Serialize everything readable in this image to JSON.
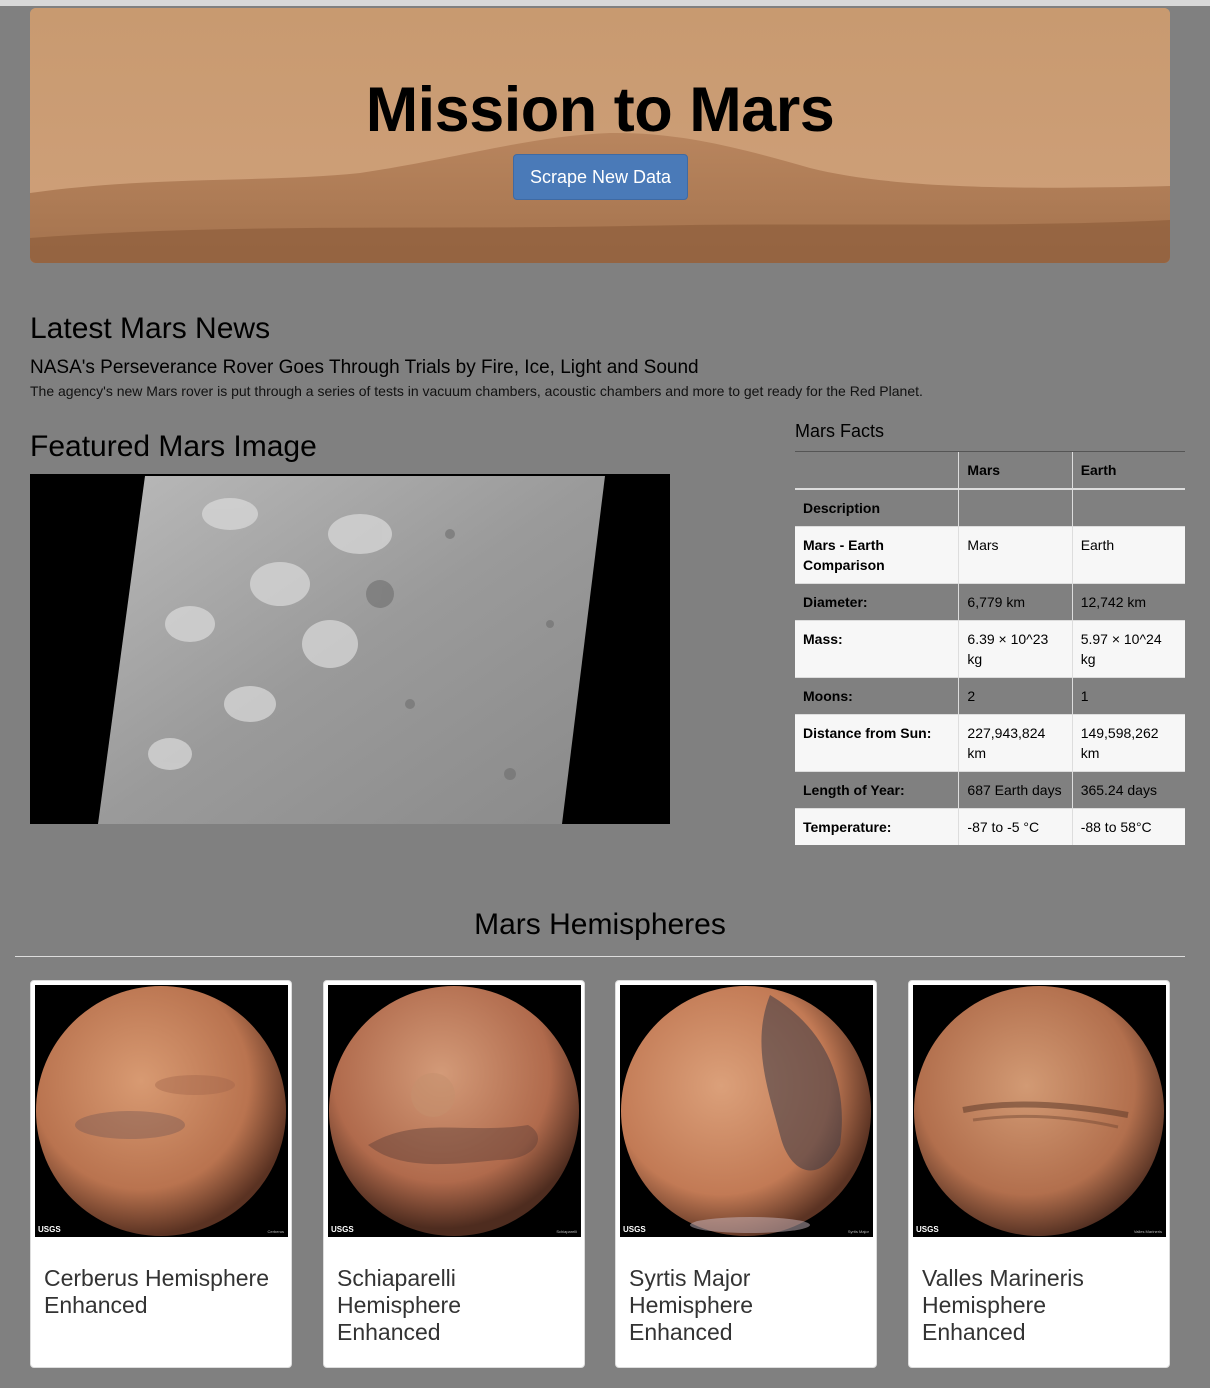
{
  "header": {
    "title": "Mission to Mars",
    "scrape_button": "Scrape New Data"
  },
  "news": {
    "heading": "Latest Mars News",
    "title": "NASA's Perseverance Rover Goes Through Trials by Fire, Ice, Light and Sound",
    "teaser": "The agency's new Mars rover is put through a series of tests in vacuum chambers, acoustic chambers and more to get ready for the Red Planet."
  },
  "featured": {
    "heading": "Featured Mars Image"
  },
  "facts": {
    "caption": "Mars Facts",
    "columns": [
      "",
      "Mars",
      "Earth"
    ],
    "rows": [
      {
        "label": "Description",
        "mars": "",
        "earth": ""
      },
      {
        "label": "Mars - Earth Comparison",
        "mars": "Mars",
        "earth": "Earth"
      },
      {
        "label": "Diameter:",
        "mars": "6,779 km",
        "earth": "12,742 km"
      },
      {
        "label": "Mass:",
        "mars": "6.39 × 10^23 kg",
        "earth": "5.97 × 10^24 kg"
      },
      {
        "label": "Moons:",
        "mars": "2",
        "earth": "1"
      },
      {
        "label": "Distance from Sun:",
        "mars": "227,943,824 km",
        "earth": "149,598,262 km"
      },
      {
        "label": "Length of Year:",
        "mars": "687 Earth days",
        "earth": "365.24 days"
      },
      {
        "label": "Temperature:",
        "mars": "-87 to -5 °C",
        "earth": "-88 to 58°C"
      }
    ]
  },
  "hemispheres": {
    "heading": "Mars Hemispheres",
    "watermark": "USGS",
    "items": [
      {
        "title": "Cerberus Hemisphere Enhanced",
        "corner": "Cerberus",
        "color": "#b9734f"
      },
      {
        "title": "Schiaparelli Hemisphere Enhanced",
        "corner": "Schiaparelli",
        "color": "#b06a4c"
      },
      {
        "title": "Syrtis Major Hemisphere Enhanced",
        "corner": "Syrtis Major",
        "color": "#c27a55"
      },
      {
        "title": "Valles Marineris Hemisphere Enhanced",
        "corner": "Valles Marineris",
        "color": "#b26f4d"
      }
    ]
  }
}
